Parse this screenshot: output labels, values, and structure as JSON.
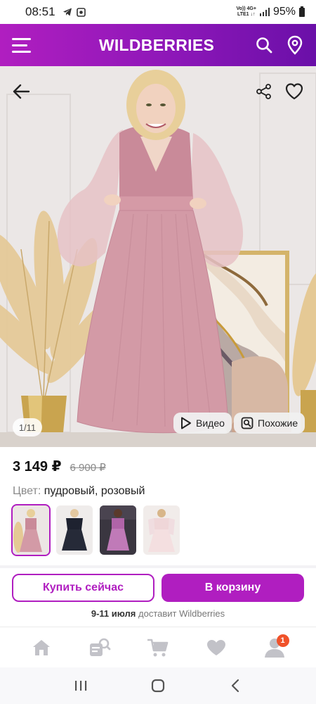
{
  "status": {
    "time": "08:51",
    "network_top": "Vo)) 4G+",
    "network_bottom": "LTE1 ↓↑",
    "battery": "95%"
  },
  "header": {
    "brand": "WILDBERRIES",
    "icons": [
      "menu-icon",
      "search-icon",
      "location-pin-icon"
    ]
  },
  "photo": {
    "counter": "1/11",
    "video_label": "Видео",
    "similar_label": "Похожие",
    "icons": [
      "back-arrow-icon",
      "share-icon",
      "heart-icon",
      "play-icon",
      "similar-search-icon"
    ]
  },
  "product": {
    "price": "3 149 ₽",
    "old_price": "6 900 ₽",
    "color_label": "Цвет:",
    "color_value": "пудровый, розовый",
    "thumbnails": [
      "pink",
      "black",
      "purple",
      "white"
    ]
  },
  "actions": {
    "buy_now": "Купить сейчас",
    "add_to_cart": "В корзину",
    "delivery_dates": "9-11 июля",
    "delivery_text": "доставит Wildberries"
  },
  "tabbar": {
    "tabs": [
      "home-icon",
      "catalog-icon",
      "cart-icon",
      "favorites-icon",
      "profile-icon"
    ],
    "profile_badge": "1"
  },
  "colors": {
    "accent": "#b01ec0",
    "header_start": "#b01ec0",
    "header_end": "#6a0fa8",
    "badge": "#f0522a"
  }
}
